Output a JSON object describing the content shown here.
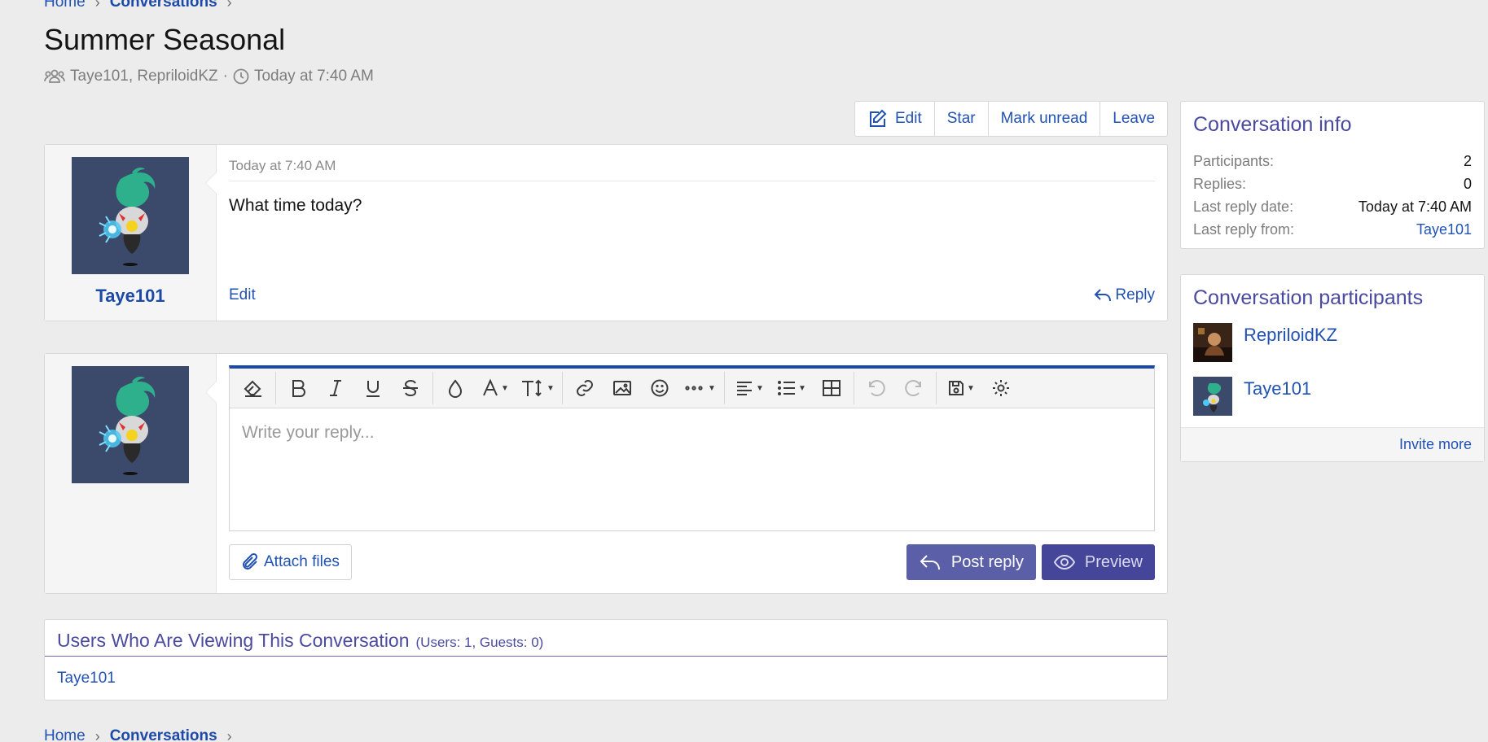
{
  "breadcrumbs": {
    "home": "Home",
    "conversations": "Conversations",
    "sep": "›"
  },
  "page": {
    "title": "Summer Seasonal",
    "participants_line": "Taye101, RepriloidKZ",
    "dot": "·",
    "time": "Today at 7:40 AM"
  },
  "actions": {
    "edit": "Edit",
    "star": "Star",
    "mark_unread": "Mark unread",
    "leave": "Leave"
  },
  "message": {
    "author": "Taye101",
    "date": "Today at 7:40 AM",
    "text": "What time today?",
    "edit": "Edit",
    "reply": "Reply"
  },
  "editor": {
    "placeholder": "Write your reply...",
    "attach": "Attach files",
    "post_reply": "Post reply",
    "preview": "Preview"
  },
  "viewers": {
    "title": "Users Who Are Viewing This Conversation",
    "count": "(Users: 1, Guests: 0)",
    "users": "Taye101"
  },
  "info": {
    "title": "Conversation info",
    "rows": [
      {
        "k": "Participants:",
        "v": "2"
      },
      {
        "k": "Replies:",
        "v": "0"
      },
      {
        "k": "Last reply date:",
        "v": "Today at 7:40 AM"
      },
      {
        "k": "Last reply from:",
        "v": "Taye101"
      }
    ]
  },
  "participants": {
    "title": "Conversation participants",
    "list": [
      "RepriloidKZ",
      "Taye101"
    ],
    "invite": "Invite more"
  },
  "colors": {
    "link": "#2152b3",
    "accent": "#1d4aa8",
    "block_title": "#4a4aa0",
    "button": "#5b5fa8"
  }
}
